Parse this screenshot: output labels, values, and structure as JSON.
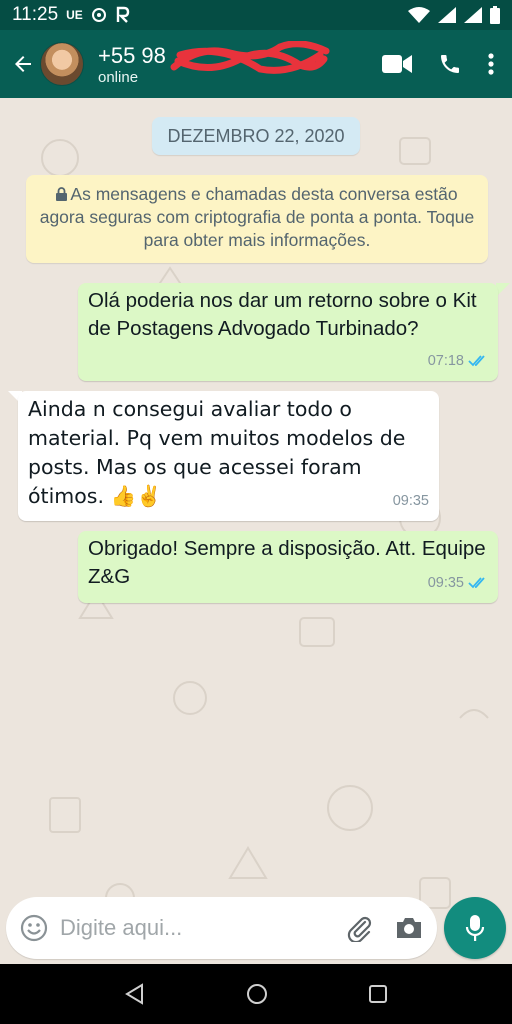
{
  "status_bar": {
    "time": "11:25",
    "indicator_text": "UE"
  },
  "header": {
    "contact_name": "+55 98",
    "contact_status": "online"
  },
  "chat": {
    "date_chip": "DEZEMBRO 22, 2020",
    "encryption_notice": "As mensagens e chamadas desta conversa estão agora seguras com criptografia de ponta a ponta. Toque para obter mais informações.",
    "messages": [
      {
        "direction": "outgoing",
        "text": "Olá poderia nos dar um retorno sobre o Kit de Postagens Advogado Turbinado?",
        "time": "07:18",
        "status": "read"
      },
      {
        "direction": "incoming",
        "text": "Ainda n consegui avaliar todo o material. Pq vem muitos modelos de posts. Mas os que acessei foram ótimos. 👍✌️",
        "time": "09:35"
      },
      {
        "direction": "outgoing",
        "text": "Obrigado! Sempre a disposição. Att. Equipe Z&G",
        "time": "09:35",
        "status": "read"
      }
    ]
  },
  "composer": {
    "placeholder": "Digite aqui...",
    "value": ""
  },
  "colors": {
    "header": "#075e54",
    "status_bar": "#054d44",
    "outgoing_bubble": "#dcf8c6",
    "incoming_bubble": "#ffffff",
    "read_ticks": "#34b7f1",
    "mic_button": "#128c7e",
    "wallpaper": "#ece5dd"
  },
  "icons": [
    "back-arrow-icon",
    "video-call-icon",
    "phone-icon",
    "more-vert-icon",
    "lock-icon",
    "emoji-icon",
    "attach-icon",
    "camera-icon",
    "mic-icon",
    "nav-back-icon",
    "nav-home-icon",
    "nav-recents-icon"
  ]
}
